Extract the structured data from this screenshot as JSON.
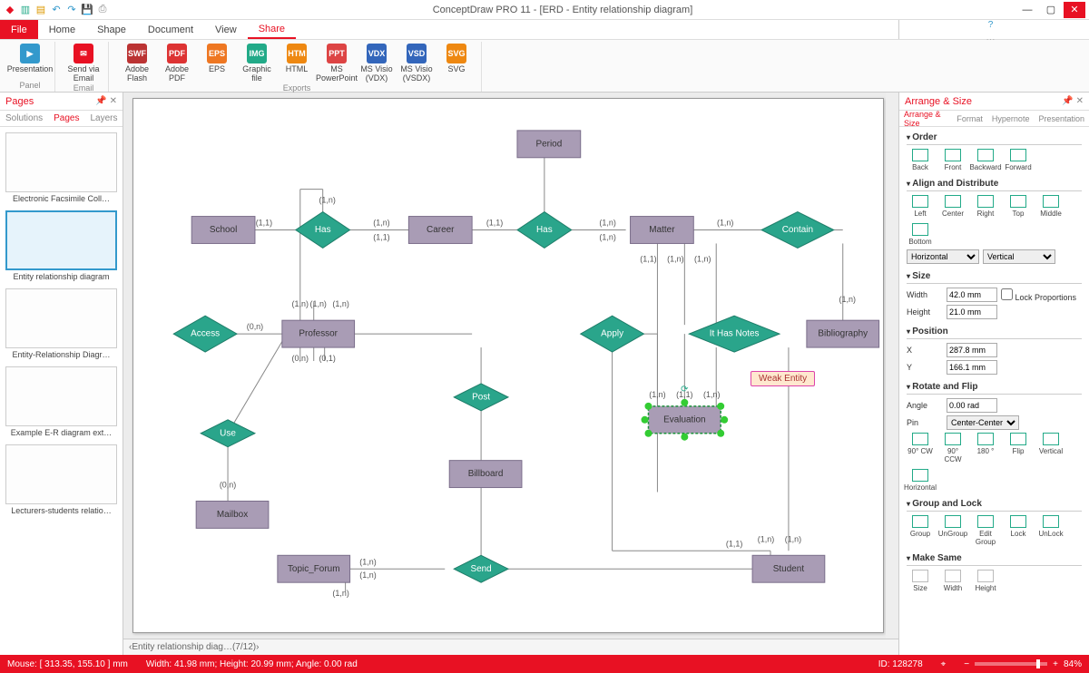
{
  "app": {
    "title": "ConceptDraw PRO 11 - [ERD - Entity relationship diagram]"
  },
  "ribbon_tabs": {
    "file": "File",
    "home": "Home",
    "shape": "Shape",
    "document": "Document",
    "view": "View",
    "share": "Share"
  },
  "ribbon": {
    "presentation": "Presentation",
    "panel": "Panel",
    "send_email": "Send via Email",
    "email": "Email",
    "flash": "Adobe Flash",
    "pdf": "Adobe PDF",
    "eps": "EPS",
    "graphic": "Graphic file",
    "html": "HTML",
    "ppt": "MS PowerPoint",
    "vdx": "MS Visio (VDX)",
    "vsdx": "MS Visio (VSDX)",
    "svg": "SVG",
    "exports": "Exports"
  },
  "left": {
    "title": "Pages",
    "tabs": {
      "solutions": "Solutions",
      "pages": "Pages",
      "layers": "Layers"
    },
    "thumbs": [
      "Electronic Facsimile Coll…",
      "Entity relationship diagram",
      "Entity-Relationship Diagr…",
      "Example E-R diagram ext…",
      "Lecturers-students relatio…"
    ]
  },
  "diagram": {
    "entities": {
      "period": "Period",
      "school": "School",
      "career": "Career",
      "matter": "Matter",
      "professor": "Professor",
      "bibliography": "Bibliography",
      "billboard": "Billboard",
      "mailbox": "Mailbox",
      "topic_forum": "Topic_Forum",
      "student": "Student",
      "evaluation": "Evaluation"
    },
    "relations": {
      "has1": "Has",
      "has2": "Has",
      "contain": "Contain",
      "access": "Access",
      "apply": "Apply",
      "it_has_notes": "It Has Notes",
      "post": "Post",
      "use": "Use",
      "send": "Send"
    },
    "card": {
      "c11": "(1,1)",
      "c1n": "(1,n)",
      "c0n": "(0,n)",
      "c01": "(0,1)"
    },
    "tooltip": "Weak Entity"
  },
  "right": {
    "title": "Arrange & Size",
    "tabs": {
      "arrange": "Arrange & Size",
      "format": "Format",
      "hypernote": "Hypernote",
      "presentation": "Presentation"
    },
    "order": {
      "title": "Order",
      "back": "Back",
      "front": "Front",
      "backward": "Backward",
      "forward": "Forward"
    },
    "align": {
      "title": "Align and Distribute",
      "left": "Left",
      "center": "Center",
      "right": "Right",
      "top": "Top",
      "middle": "Middle",
      "bottom": "Bottom",
      "horizontal": "Horizontal",
      "vertical": "Vertical"
    },
    "size": {
      "title": "Size",
      "width_l": "Width",
      "width_v": "42.0 mm",
      "height_l": "Height",
      "height_v": "21.0 mm",
      "lock": "Lock Proportions"
    },
    "position": {
      "title": "Position",
      "x_l": "X",
      "x_v": "287.8 mm",
      "y_l": "Y",
      "y_v": "166.1 mm"
    },
    "rotate": {
      "title": "Rotate and Flip",
      "angle_l": "Angle",
      "angle_v": "0.00 rad",
      "pin_l": "Pin",
      "pin_v": "Center-Center",
      "cw": "90° CW",
      "ccw": "90° CCW",
      "r180": "180 °",
      "flip": "Flip",
      "vert": "Vertical",
      "horiz": "Horizontal"
    },
    "group": {
      "title": "Group and Lock",
      "group": "Group",
      "ungroup": "UnGroup",
      "edit": "Edit Group",
      "lock": "Lock",
      "unlock": "UnLock"
    },
    "same": {
      "title": "Make Same",
      "size": "Size",
      "width": "Width",
      "height": "Height"
    }
  },
  "tabbar": {
    "sheet": "Entity relationship diag…",
    "pages": "(7/12)"
  },
  "status": {
    "mouse": "Mouse: [ 313.35, 155.10 ] mm",
    "dims": "Width: 41.98 mm;  Height: 20.99 mm;  Angle: 0.00 rad",
    "id": "ID: 128278",
    "zoom": "84%"
  }
}
